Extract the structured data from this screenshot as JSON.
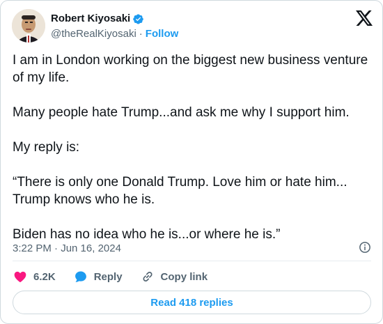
{
  "author": {
    "display_name": "Robert Kiyosaki",
    "handle": "@theRealKiyosaki",
    "separator": "·",
    "follow_label": "Follow",
    "verified_icon": "verified-badge-icon",
    "avatar_icon": "avatar"
  },
  "tweet": {
    "paragraphs": [
      "I am in London working on the biggest new business venture of my life.",
      "Many people hate Trump...and ask me why I support him.",
      "My reply is:",
      "“There is only one Donald Trump.  Love him or hate him... Trump knows who he is.",
      "Biden has no idea who he is...or where he is.”"
    ]
  },
  "meta": {
    "timestamp": "3:22 PM · Jun 16, 2024"
  },
  "actions": {
    "likes": "6.2K",
    "reply_label": "Reply",
    "copy_link_label": "Copy link"
  },
  "footer": {
    "read_replies_label": "Read 418 replies"
  },
  "colors": {
    "accent": "#1d9bf0",
    "like": "#f91880",
    "text": "#0f1419",
    "muted": "#536471",
    "border": "#cfd9de"
  }
}
